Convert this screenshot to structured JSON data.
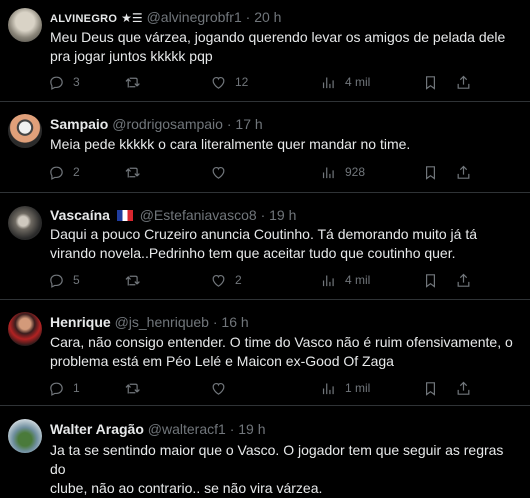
{
  "tweets": [
    {
      "name": "ALVINEGRO",
      "name_badge": "★☰",
      "handle": "@alvinegrobfr1",
      "sep": "·",
      "time": "20 h",
      "text": [
        "Meu Deus que várzea, jogando querendo levar os amigos de pelada dele",
        "pra jogar juntos kkkkk pqp"
      ],
      "replies": "3",
      "retweets": "",
      "likes": "12",
      "views": "4 mil"
    },
    {
      "name": "Sampaio",
      "handle": "@rodrigosampaio",
      "sep": "·",
      "time": "17 h",
      "text": [
        "Meia pede kkkkk o cara literalmente quer mandar no time."
      ],
      "replies": "2",
      "retweets": "",
      "likes": "",
      "views": "928"
    },
    {
      "name": "Vascaína",
      "handle": "@Estefaniavasco8",
      "sep": "·",
      "time": "19 h",
      "text": [
        "Daqui a pouco Cruzeiro anuncia Coutinho.  Tá demorando muito já tá",
        "virando novela..Pedrinho tem que aceitar tudo que coutinho quer."
      ],
      "replies": "5",
      "retweets": "",
      "likes": "2",
      "views": "4 mil"
    },
    {
      "name": "Henrique",
      "handle": "@js_henriqueb",
      "sep": "·",
      "time": "16 h",
      "text": [
        "Cara, não consigo entender. O time do Vasco não é ruim ofensivamente, o",
        "problema está em Péo Lelé e Maicon ex-Good Of Zaga"
      ],
      "replies": "1",
      "retweets": "",
      "likes": "",
      "views": "1 mil"
    },
    {
      "name": "Walter Aragão",
      "handle": "@walteracf1",
      "sep": "·",
      "time": "19 h",
      "text": [
        "Ja ta se sentindo maior que o Vasco. O jogador tem que seguir as regras do",
        "clube, não ao contrario.. se não vira várzea."
      ]
    }
  ],
  "colors": {
    "background": "#000000",
    "text": "#e7e9ea",
    "muted": "#71767b",
    "divider": "#2f3336"
  }
}
